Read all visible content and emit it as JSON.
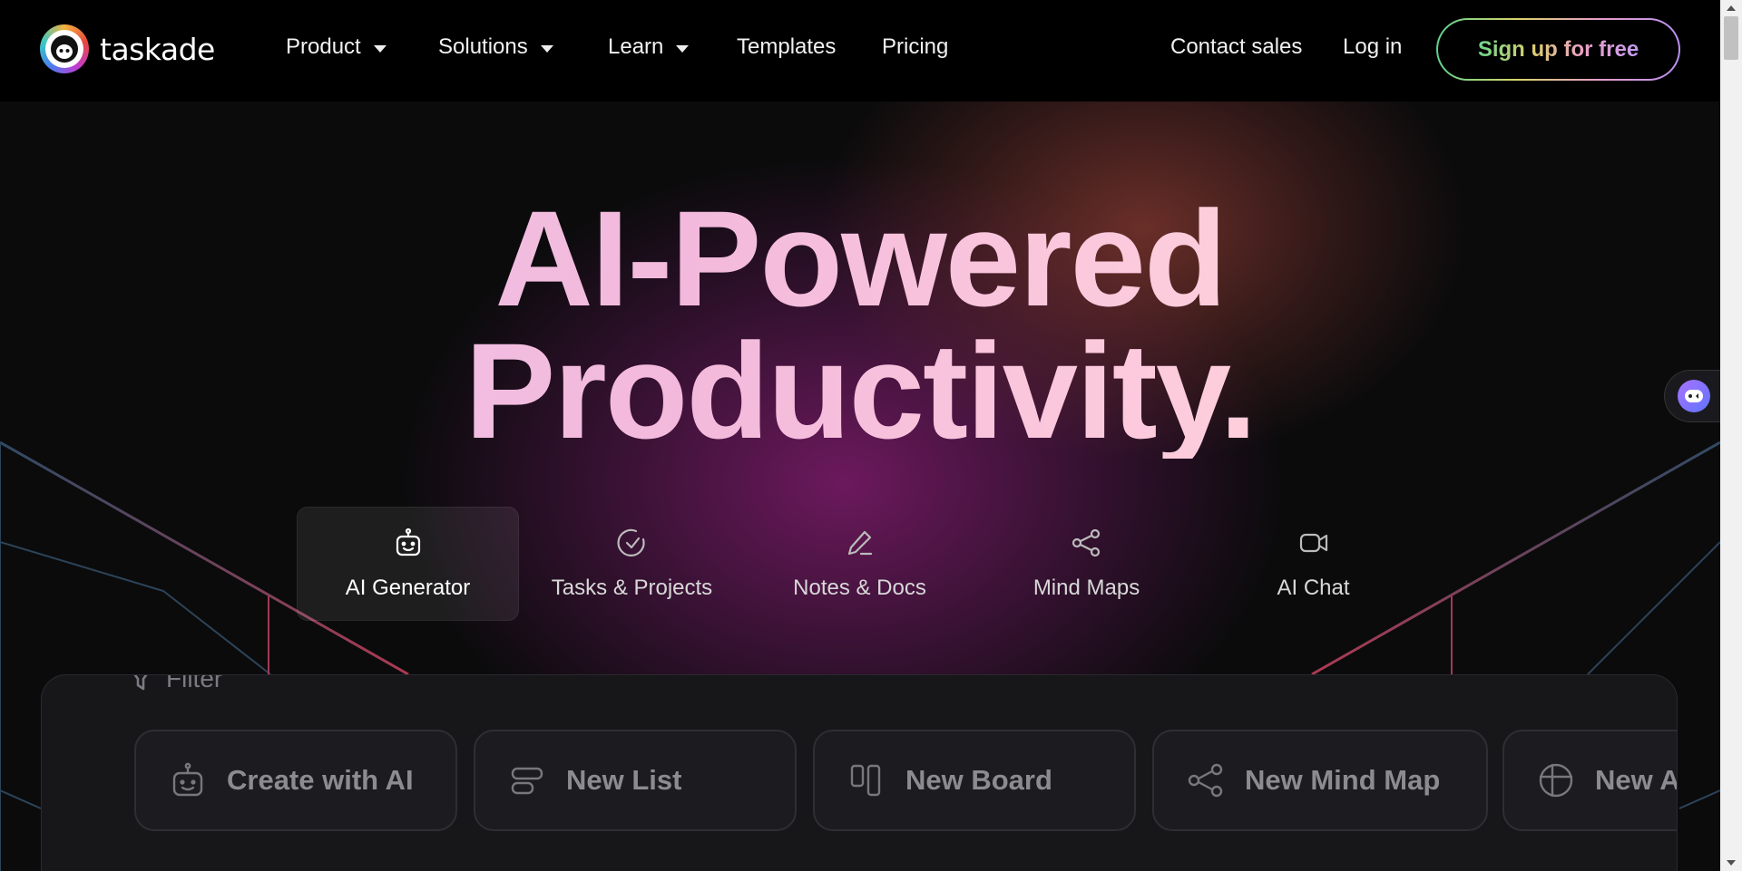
{
  "brand": {
    "name": "taskade",
    "logo_icon": "taskade-sheep-icon"
  },
  "nav": {
    "items": [
      {
        "label": "Product",
        "has_dropdown": true
      },
      {
        "label": "Solutions",
        "has_dropdown": true
      },
      {
        "label": "Learn",
        "has_dropdown": true
      },
      {
        "label": "Templates",
        "has_dropdown": false
      },
      {
        "label": "Pricing",
        "has_dropdown": false
      }
    ],
    "contact_sales": "Contact sales",
    "login": "Log in",
    "signup": "Sign up for free"
  },
  "hero": {
    "line1": "AI-Powered",
    "line2": "Productivity."
  },
  "tabs": [
    {
      "label": "AI Generator",
      "icon": "robot-icon",
      "active": true
    },
    {
      "label": "Tasks & Projects",
      "icon": "check-circle-icon",
      "active": false
    },
    {
      "label": "Notes & Docs",
      "icon": "pencil-icon",
      "active": false
    },
    {
      "label": "Mind Maps",
      "icon": "share-nodes-icon",
      "active": false
    },
    {
      "label": "AI Chat",
      "icon": "video-icon",
      "active": false
    }
  ],
  "panel": {
    "filter_label": "Filter",
    "cards": [
      {
        "label": "Create with AI",
        "icon": "robot-icon"
      },
      {
        "label": "New List",
        "icon": "list-icon"
      },
      {
        "label": "New Board",
        "icon": "board-icon"
      },
      {
        "label": "New Mind Map",
        "icon": "share-nodes-icon"
      },
      {
        "label": "New A",
        "icon": "globe-grid-icon"
      }
    ]
  },
  "colors": {
    "nav_bg": "#000000",
    "page_bg": "#0b0b0c",
    "glow_magenta": "#8c1e78",
    "glow_orange": "#aa463c",
    "signup_gradient_start": "#5ed08e",
    "signup_gradient_end": "#b890f0"
  }
}
